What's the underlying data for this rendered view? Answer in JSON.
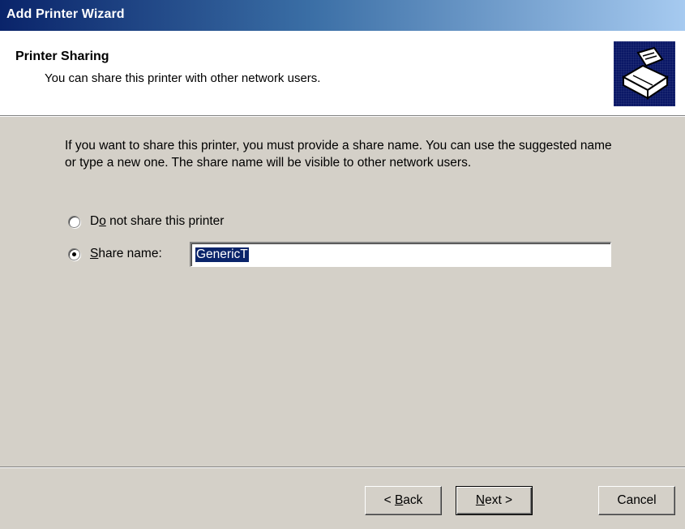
{
  "window": {
    "title": "Add Printer Wizard"
  },
  "header": {
    "title": "Printer Sharing",
    "subtitle": "You can share this printer with other network users.",
    "icon": "printer-icon"
  },
  "body": {
    "instructions": "If you want to share this printer, you must provide a share name. You can use the suggested name or type a new one. The share name will be visible to other network users."
  },
  "options": {
    "no_share": {
      "label_pre": "D",
      "label_accel": "o",
      "label_post": " not share this printer",
      "selected": false
    },
    "share": {
      "label_pre": "",
      "label_accel": "S",
      "label_post": "hare name:",
      "selected": true
    },
    "share_name_value": "GenericT"
  },
  "buttons": {
    "back": {
      "pre": "< ",
      "accel": "B",
      "post": "ack"
    },
    "next": {
      "pre": "",
      "accel": "N",
      "post": "ext >"
    },
    "cancel": "Cancel"
  },
  "colors": {
    "titlebar_start": "#0a246a",
    "titlebar_end": "#a6caf0",
    "dialog_face": "#d4d0c8",
    "selection": "#0a246a"
  }
}
